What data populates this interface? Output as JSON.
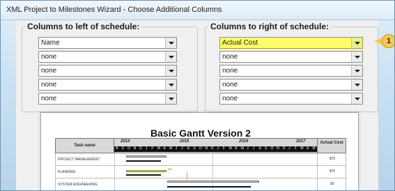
{
  "window": {
    "title": "XML Project to Milestones Wizard - Choose Additional Columns"
  },
  "left_group": {
    "legend": "Columns to left of schedule:",
    "selects": [
      "Name",
      "none",
      "none",
      "none",
      "none"
    ]
  },
  "right_group": {
    "legend": "Columns to right of schedule:",
    "selects": [
      "Actual Cost",
      "none",
      "none",
      "none",
      "none"
    ],
    "highlight_color": "#ffff66"
  },
  "callout": {
    "number": "1",
    "color": "#f7c94a"
  },
  "preview": {
    "title": "Basic Gantt Version 2",
    "task_header": "Task name",
    "cost_header": "Actual Cost",
    "years": [
      "2014",
      "2015",
      "2016",
      "2017"
    ],
    "months": [
      "A",
      "S",
      "O",
      "N",
      "D",
      "J",
      "F",
      "M",
      "A",
      "M",
      "J",
      "J",
      "A",
      "S",
      "O",
      "N",
      "D",
      "J",
      "F",
      "M",
      "A",
      "M",
      "J",
      "J",
      "A",
      "S",
      "O",
      "N",
      "D",
      "J",
      "F",
      "M",
      "A",
      "M"
    ],
    "rows": [
      {
        "task": "PROJECT MANAGEMENT",
        "cost": "$70"
      },
      {
        "task": "PLANNING",
        "cost": "$70",
        "pct": "0%"
      },
      {
        "task": "SYSTEM ENGINEERING",
        "cost": "$0"
      }
    ],
    "bar_colors": {
      "summary": "#9d9d9d",
      "task": "#f5f37a"
    }
  }
}
